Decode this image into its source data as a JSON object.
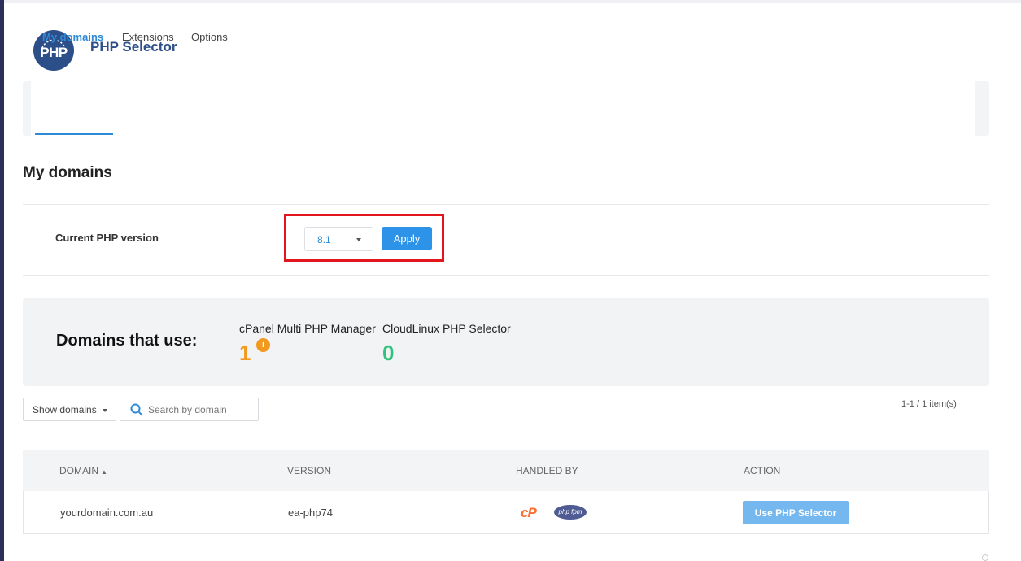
{
  "header": {
    "logo_text": "PHP",
    "title": "PHP Selector"
  },
  "tabs": [
    {
      "label": "My domains",
      "active": true
    },
    {
      "label": "Extensions",
      "active": false
    },
    {
      "label": "Options",
      "active": false
    }
  ],
  "section_title": "My domains",
  "php_version": {
    "label": "Current PHP version",
    "selected": "8.1",
    "apply_label": "Apply"
  },
  "stats": {
    "label": "Domains that use:",
    "cpanel": {
      "label": "cPanel Multi PHP Manager",
      "value": "1",
      "info_icon": "i"
    },
    "cloudlinux": {
      "label": "CloudLinux PHP Selector",
      "value": "0"
    }
  },
  "toolbar": {
    "show_domains_label": "Show domains",
    "search_placeholder": "Search by domain",
    "pagination": "1-1 / 1 item(s)"
  },
  "table": {
    "columns": [
      "DOMAIN",
      "VERSION",
      "HANDLED BY",
      "ACTION"
    ],
    "sort_indicator": "▲",
    "rows": [
      {
        "domain": "yourdomain.com.au",
        "version": "ea-php74",
        "handlers": [
          "cP",
          "php fpm"
        ],
        "action_label": "Use PHP Selector"
      }
    ]
  },
  "colors": {
    "accent": "#2d8ad7",
    "brand": "#2c4f8a",
    "highlight": "#e3161d",
    "warning": "#f29a1f",
    "success": "#2fc37c",
    "cpanel_orange": "#ff6c2c"
  },
  "icons": [
    "php-logo-icon",
    "caret-down-icon",
    "info-icon",
    "search-icon",
    "cpanel-logo-icon",
    "php-fpm-logo-icon"
  ]
}
